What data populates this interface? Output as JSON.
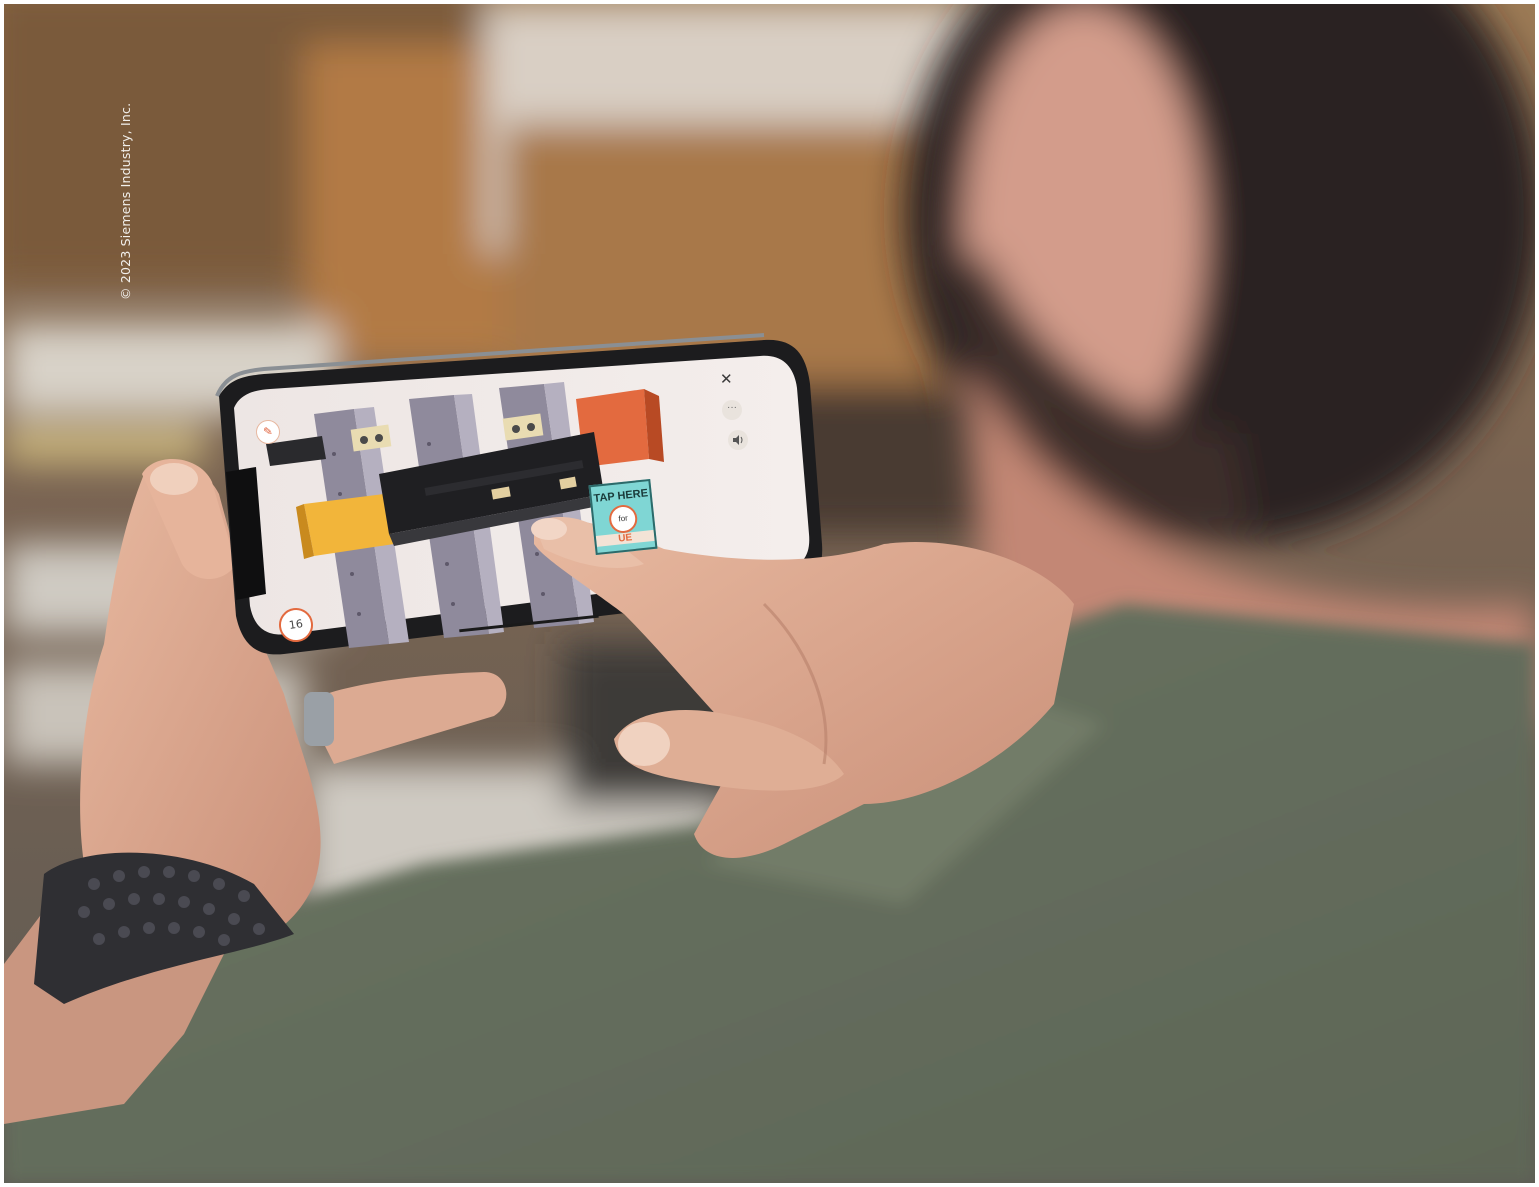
{
  "photo": {
    "copyright": "© 2023 Siemens Industry, Inc."
  },
  "phone_screen": {
    "close_glyph": "✕",
    "more_glyph": "···",
    "speaker_icon": "speaker-icon",
    "edit_icon": "pencil-icon",
    "page_indicator": "16",
    "callout_title": "TAP HERE",
    "callout_badge": "for",
    "callout_tail": "UE"
  },
  "colors": {
    "accent_orange": "#e36a3f",
    "callout_teal": "#7fd6d4",
    "busbar_yellow": "#f2b53a",
    "shirt_green": "#6f7a63"
  }
}
